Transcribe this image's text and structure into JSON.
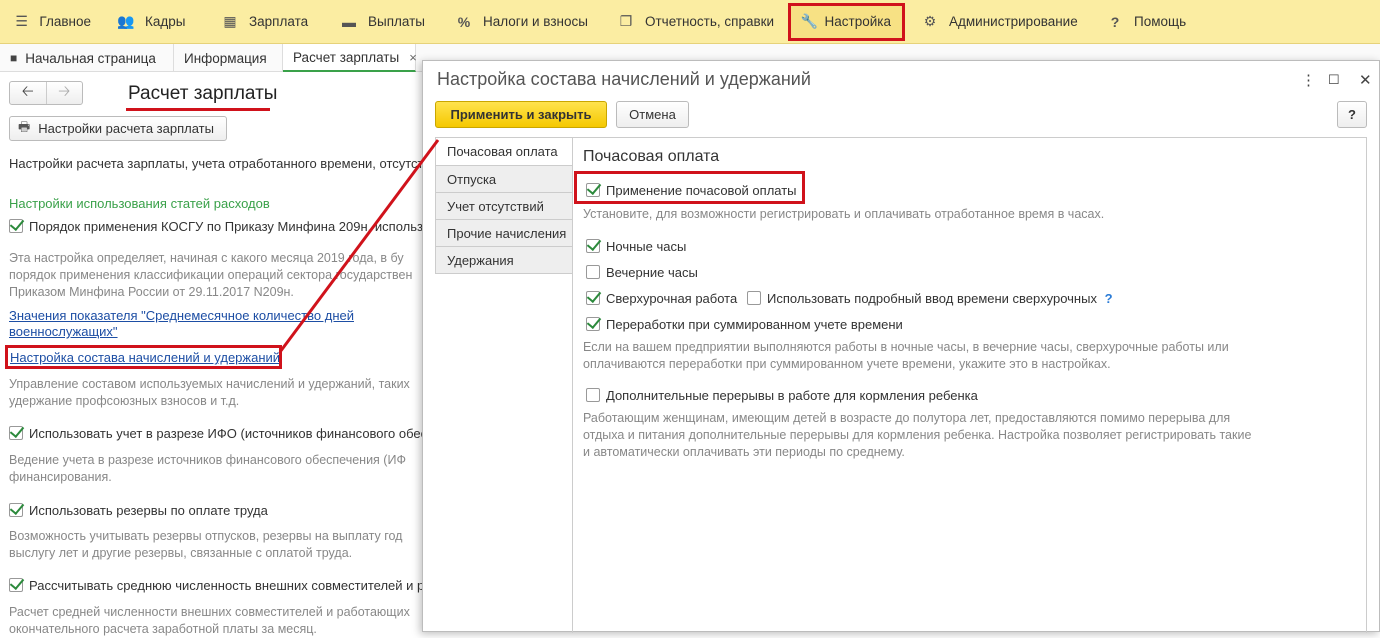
{
  "topmenu": {
    "items": [
      {
        "label": "Главное",
        "icon": "hamburger-icon"
      },
      {
        "label": "Кадры",
        "icon": "people-icon"
      },
      {
        "label": "Зарплата",
        "icon": "calculator-icon"
      },
      {
        "label": "Выплаты",
        "icon": "wallet-icon"
      },
      {
        "label": "Налоги и взносы",
        "icon": "percent-icon"
      },
      {
        "label": "Отчетность, справки",
        "icon": "documents-icon"
      },
      {
        "label": "Настройка",
        "icon": "wrench-icon"
      },
      {
        "label": "Администрирование",
        "icon": "gear-icon"
      },
      {
        "label": "Помощь",
        "icon": "question-icon"
      }
    ]
  },
  "tabs": {
    "home": "Начальная страница",
    "info": "Информация",
    "payroll": "Расчет зарплаты",
    "close": "×"
  },
  "left": {
    "title": "Расчет зарплаты",
    "settings_button": "Настройки расчета зарплаты",
    "intro": "Настройки расчета зарплаты, учета отработанного времени, отсутств",
    "section_title": "Настройки использования статей расходов",
    "kosgu_label": "Порядок применения КОСГУ по Приказу Минфина 209н, использу",
    "kosgu_desc": [
      "Эта настройка определяет, начиная с какого месяца 2019 года, в бу",
      "порядок применения классификации операций сектора государствен",
      "Приказом Минфина России от 29.11.2017 N209н."
    ],
    "link_indicators": [
      "Значения показателя \"Среднемесячное количество дней",
      "военнослужащих\""
    ],
    "link_composition": "Настройка состава начислений и удержаний",
    "composition_desc": [
      "Управление составом используемых начислений и удержаний, таких",
      "удержание профсоюзных взносов и т.д."
    ],
    "ifo_label": "Использовать учет в разрезе ИФО (источников финансового обес",
    "ifo_desc": [
      "Ведение учета в разрезе источников финансового обеспечения (ИФ",
      "финансирования."
    ],
    "reserves_label": "Использовать резервы по оплате труда",
    "reserves_desc": [
      "Возможность учитывать резервы отпусков,  резервы на выплату год",
      "выслугу лет и другие резервы, связанные с оплатой труда."
    ],
    "avg_label": "Рассчитывать среднюю численность внешних совместителей и р",
    "avg_desc": [
      "Расчет средней численности внешних совместителей и работающих",
      "окончательного расчета заработной платы за месяц."
    ]
  },
  "dialog": {
    "title": "Настройка состава начислений и удержаний",
    "more": "⋮",
    "maximize": "☐",
    "close": "✕",
    "apply_button": "Применить и закрыть",
    "cancel_button": "Отмена",
    "help_button": "?",
    "tabs": [
      "Почасовая оплата",
      "Отпуска",
      "Учет отсутствий",
      "Прочие начисления",
      "Удержания"
    ],
    "section_title": "Почасовая оплата",
    "hourly_label": "Применение почасовой оплаты",
    "hourly_desc": "Установите, для возможности регистрировать и оплачивать отработанное время в часах.",
    "night_label": "Ночные часы",
    "evening_label": "Вечерние часы",
    "overtime_label": "Сверхурочная работа",
    "overtime_detail_label": "Использовать подробный ввод времени сверхурочных",
    "overtime_help": "?",
    "summarized_label": "Переработки при суммированном учете времени",
    "summarized_desc": [
      "Если на вашем предприятии выполняются работы в ночные часы, в вечерние часы, сверхурочные работы или",
      "оплачиваются переработки при суммированном учете времени, укажите это в настройках."
    ],
    "breaks_label": "Дополнительные перерывы в работе для кормления ребенка",
    "breaks_desc": [
      "Работающим женщинам, имеющим детей в возрасте до полутора лет, предоставляются помимо перерыва для",
      "отдыха и питания дополнительные перерывы для кормления ребенка. Настройка позволяет регистрировать такие",
      "и автоматически оплачивать эти периоды по среднему."
    ]
  },
  "colors": {
    "highlight": "#d0121b",
    "menubar": "#fbeda2",
    "section_green": "#3aa14a",
    "primary_button": "#f5c800"
  }
}
